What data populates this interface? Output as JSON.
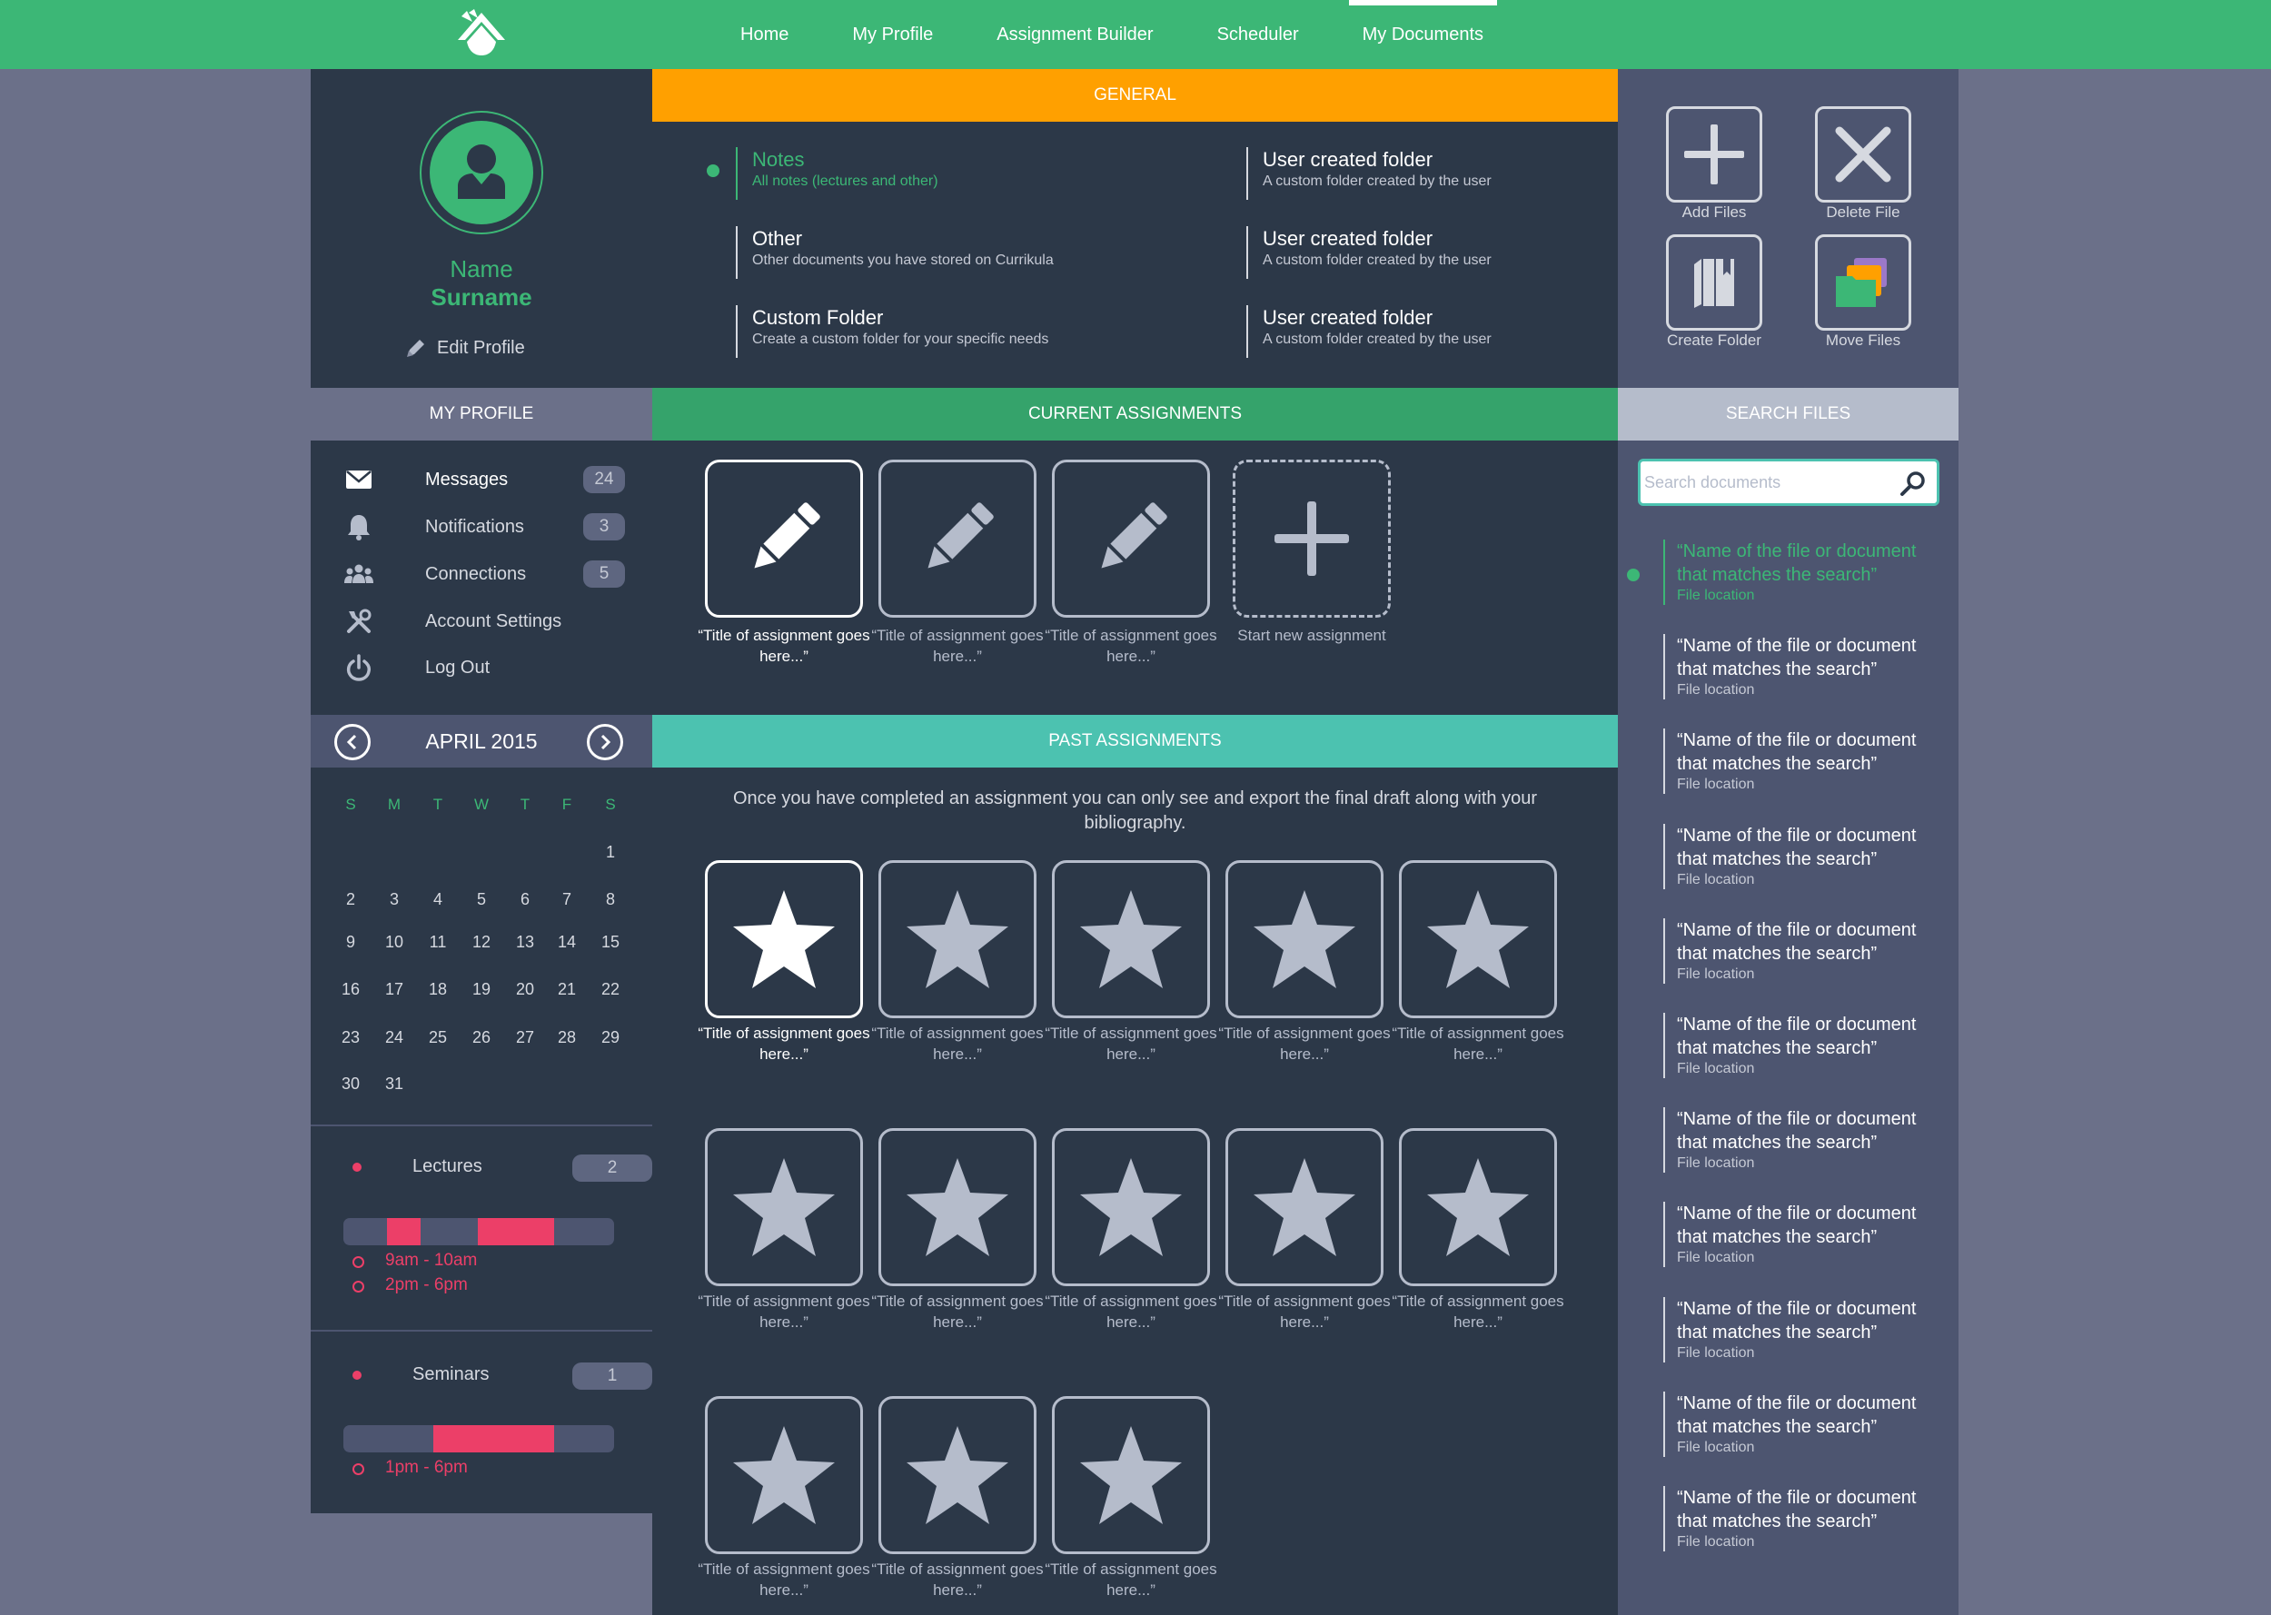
{
  "nav": {
    "items": [
      {
        "label": "Home",
        "active": false
      },
      {
        "label": "My Profile",
        "active": false
      },
      {
        "label": "Assignment Builder",
        "active": false
      },
      {
        "label": "Scheduler",
        "active": false
      },
      {
        "label": "My Documents",
        "active": true
      }
    ]
  },
  "profile": {
    "name": "Name",
    "surname": "Surname",
    "edit_label": "Edit Profile",
    "section_title": "MY PROFILE"
  },
  "menu": {
    "items": [
      {
        "label": "Messages",
        "icon": "envelope-icon",
        "badge": "24"
      },
      {
        "label": "Notifications",
        "icon": "bell-icon",
        "badge": "3"
      },
      {
        "label": "Connections",
        "icon": "people-icon",
        "badge": "5"
      },
      {
        "label": "Account Settings",
        "icon": "tools-icon",
        "badge": ""
      },
      {
        "label": "Log Out",
        "icon": "power-icon",
        "badge": ""
      }
    ]
  },
  "calendar": {
    "month": "APRIL 2015",
    "days_of_week": [
      "S",
      "M",
      "T",
      "W",
      "T",
      "F",
      "S"
    ],
    "weeks": [
      [
        "",
        "",
        "",
        "",
        "",
        "",
        "1"
      ],
      [
        "2",
        "3",
        "4",
        "5",
        "6",
        "7",
        "8"
      ],
      [
        "9",
        "10",
        "11",
        "12",
        "13",
        "14",
        "15"
      ],
      [
        "16",
        "17",
        "18",
        "19",
        "20",
        "21",
        "22"
      ],
      [
        "23",
        "24",
        "25",
        "26",
        "27",
        "28",
        "29"
      ],
      [
        "30",
        "31",
        "",
        "",
        "",
        "",
        ""
      ]
    ]
  },
  "events": {
    "lectures": {
      "title": "Lectures",
      "count": "2",
      "times": [
        "9am - 10am",
        "2pm - 6pm"
      ]
    },
    "seminars": {
      "title": "Seminars",
      "count": "1",
      "times": [
        "1pm - 6pm"
      ]
    }
  },
  "general": {
    "title": "GENERAL",
    "folders": [
      {
        "title": "Notes",
        "sub": "All notes (lectures and other)",
        "active": true
      },
      {
        "title": "Other",
        "sub": "Other documents you have stored on Currikula",
        "active": false
      },
      {
        "title": "Custom Folder",
        "sub": "Create a custom folder for your specific needs",
        "active": false
      },
      {
        "title": "User created folder",
        "sub": "A custom folder created by the user",
        "active": false
      },
      {
        "title": "User created folder",
        "sub": "A custom folder created by the user",
        "active": false
      },
      {
        "title": "User created folder",
        "sub": "A custom folder created by the user",
        "active": false
      }
    ]
  },
  "current": {
    "title": "CURRENT ASSIGNMENTS",
    "items": [
      {
        "caption": "“Title of assignment goes here...”"
      },
      {
        "caption": "“Title of assignment goes here...”"
      },
      {
        "caption": "“Title of assignment goes here...”"
      }
    ],
    "new_label": "Start new assignment"
  },
  "past": {
    "title": "PAST ASSIGNMENTS",
    "intro": "Once you have completed an assignment you can only see and export the final draft along with your bibliography.",
    "items": [
      {
        "caption": "“Title of assignment goes here...”"
      },
      {
        "caption": "“Title of assignment goes here...”"
      },
      {
        "caption": "“Title of assignment goes here...”"
      },
      {
        "caption": "“Title of assignment goes here...”"
      },
      {
        "caption": "“Title of assignment goes here...”"
      },
      {
        "caption": "“Title of assignment goes here...”"
      },
      {
        "caption": "“Title of assignment goes here...”"
      },
      {
        "caption": "“Title of assignment goes here...”"
      },
      {
        "caption": "“Title of assignment goes here...”"
      },
      {
        "caption": "“Title of assignment goes here...”"
      },
      {
        "caption": "“Title of assignment goes here...”"
      },
      {
        "caption": "“Title of assignment goes here...”"
      },
      {
        "caption": "“Title of assignment goes here...”"
      }
    ]
  },
  "actions": {
    "add": "Add Files",
    "delete": "Delete File",
    "create_folder": "Create Folder",
    "move": "Move Files"
  },
  "search": {
    "title": "SEARCH FILES",
    "placeholder": "Search documents",
    "results": [
      {
        "title": "“Name of the file or document that matches the search”",
        "location": "File location",
        "active": true
      },
      {
        "title": "“Name of the file or document that matches the search”",
        "location": "File location",
        "active": false
      },
      {
        "title": "“Name of the file or document that matches the search”",
        "location": "File location",
        "active": false
      },
      {
        "title": "“Name of the file or document that matches the search”",
        "location": "File location",
        "active": false
      },
      {
        "title": "“Name of the file or document that matches the search”",
        "location": "File location",
        "active": false
      },
      {
        "title": "“Name of the file or document that matches the search”",
        "location": "File location",
        "active": false
      },
      {
        "title": "“Name of the file or document that matches the search”",
        "location": "File location",
        "active": false
      },
      {
        "title": "“Name of the file or document that matches the search”",
        "location": "File location",
        "active": false
      },
      {
        "title": "“Name of the file or document that matches the search”",
        "location": "File location",
        "active": false
      },
      {
        "title": "“Name of the file or document that matches the search”",
        "location": "File location",
        "active": false
      },
      {
        "title": "“Name of the file or document that matches the search”",
        "location": "File location",
        "active": false
      }
    ]
  },
  "colors": {
    "brand_green": "#3cb776",
    "general_orange": "#ffa000",
    "current_green": "#35a36b",
    "past_teal": "#4cc2b0",
    "event_pink": "#ec3f68"
  }
}
